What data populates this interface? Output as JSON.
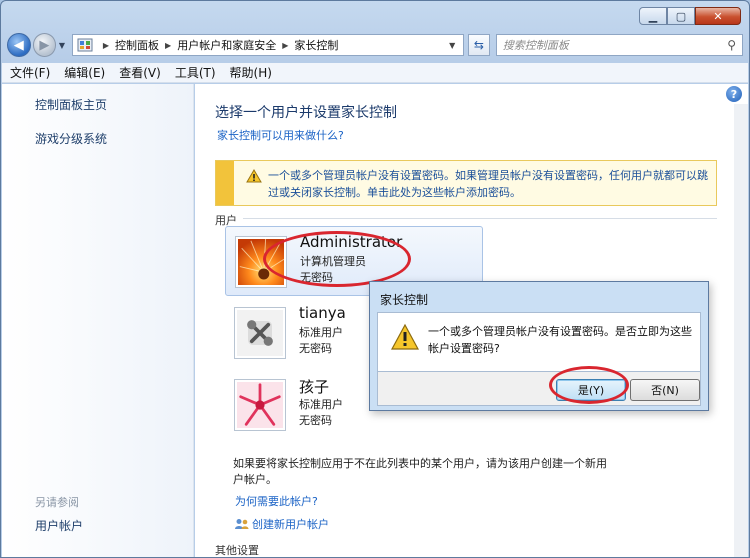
{
  "navigation": {
    "breadcrumb": [
      "控制面板",
      "用户帐户和家庭安全",
      "家长控制"
    ],
    "search_placeholder": "搜索控制面板"
  },
  "menu": [
    "文件(F)",
    "编辑(E)",
    "查看(V)",
    "工具(T)",
    "帮助(H)"
  ],
  "sidebar": {
    "home_link": "控制面板主页",
    "games_link": "游戏分级系统",
    "see_also": "另请参阅",
    "user_accounts_link": "用户帐户"
  },
  "content": {
    "title": "选择一个用户并设置家长控制",
    "subtitle_link": "家长控制可以用来做什么?",
    "warning_text": "一个或多个管理员帐户没有设置密码。如果管理员帐户没有设置密码，任何用户就都可以跳过或关闭家长控制。单击此处为这些帐户添加密码。",
    "users_label": "用户",
    "users": [
      {
        "name": "Administrator",
        "role": "计算机管理员",
        "password": "无密码"
      },
      {
        "name": "tianya",
        "role": "标准用户",
        "password": "无密码"
      },
      {
        "name": "孩子",
        "role": "标准用户",
        "password": "无密码"
      }
    ],
    "footer_text": "如果要将家长控制应用于不在此列表中的某个用户，请为该用户创建一个新用户帐户。",
    "why_link": "为何需要此帐户?",
    "create_link": "创建新用户帐户",
    "other_settings": "其他设置"
  },
  "dialog": {
    "title": "家长控制",
    "message": "一个或多个管理员帐户没有设置密码。是否立即为这些帐户设置密码?",
    "yes_button": "是(Y)",
    "no_button": "否(N)"
  },
  "colors": {
    "highlight_ellipse": "#d9262f",
    "link": "#1b63c6",
    "warning_bar": "#f2c33b"
  }
}
